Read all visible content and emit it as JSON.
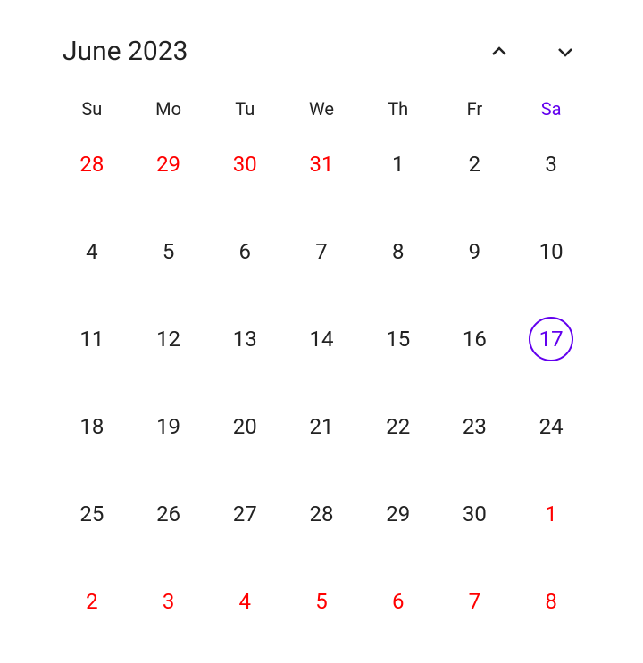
{
  "header": {
    "title": "June 2023"
  },
  "weekdays": [
    "Su",
    "Mo",
    "Tu",
    "We",
    "Th",
    "Fr",
    "Sa"
  ],
  "todayColumnIndex": 6,
  "days": [
    {
      "n": "28",
      "otherMonth": true,
      "today": false
    },
    {
      "n": "29",
      "otherMonth": true,
      "today": false
    },
    {
      "n": "30",
      "otherMonth": true,
      "today": false
    },
    {
      "n": "31",
      "otherMonth": true,
      "today": false
    },
    {
      "n": "1",
      "otherMonth": false,
      "today": false
    },
    {
      "n": "2",
      "otherMonth": false,
      "today": false
    },
    {
      "n": "3",
      "otherMonth": false,
      "today": false
    },
    {
      "n": "4",
      "otherMonth": false,
      "today": false
    },
    {
      "n": "5",
      "otherMonth": false,
      "today": false
    },
    {
      "n": "6",
      "otherMonth": false,
      "today": false
    },
    {
      "n": "7",
      "otherMonth": false,
      "today": false
    },
    {
      "n": "8",
      "otherMonth": false,
      "today": false
    },
    {
      "n": "9",
      "otherMonth": false,
      "today": false
    },
    {
      "n": "10",
      "otherMonth": false,
      "today": false
    },
    {
      "n": "11",
      "otherMonth": false,
      "today": false
    },
    {
      "n": "12",
      "otherMonth": false,
      "today": false
    },
    {
      "n": "13",
      "otherMonth": false,
      "today": false
    },
    {
      "n": "14",
      "otherMonth": false,
      "today": false
    },
    {
      "n": "15",
      "otherMonth": false,
      "today": false
    },
    {
      "n": "16",
      "otherMonth": false,
      "today": false
    },
    {
      "n": "17",
      "otherMonth": false,
      "today": true
    },
    {
      "n": "18",
      "otherMonth": false,
      "today": false
    },
    {
      "n": "19",
      "otherMonth": false,
      "today": false
    },
    {
      "n": "20",
      "otherMonth": false,
      "today": false
    },
    {
      "n": "21",
      "otherMonth": false,
      "today": false
    },
    {
      "n": "22",
      "otherMonth": false,
      "today": false
    },
    {
      "n": "23",
      "otherMonth": false,
      "today": false
    },
    {
      "n": "24",
      "otherMonth": false,
      "today": false
    },
    {
      "n": "25",
      "otherMonth": false,
      "today": false
    },
    {
      "n": "26",
      "otherMonth": false,
      "today": false
    },
    {
      "n": "27",
      "otherMonth": false,
      "today": false
    },
    {
      "n": "28",
      "otherMonth": false,
      "today": false
    },
    {
      "n": "29",
      "otherMonth": false,
      "today": false
    },
    {
      "n": "30",
      "otherMonth": false,
      "today": false
    },
    {
      "n": "1",
      "otherMonth": true,
      "today": false
    },
    {
      "n": "2",
      "otherMonth": true,
      "today": false
    },
    {
      "n": "3",
      "otherMonth": true,
      "today": false
    },
    {
      "n": "4",
      "otherMonth": true,
      "today": false
    },
    {
      "n": "5",
      "otherMonth": true,
      "today": false
    },
    {
      "n": "6",
      "otherMonth": true,
      "today": false
    },
    {
      "n": "7",
      "otherMonth": true,
      "today": false
    },
    {
      "n": "8",
      "otherMonth": true,
      "today": false
    }
  ]
}
